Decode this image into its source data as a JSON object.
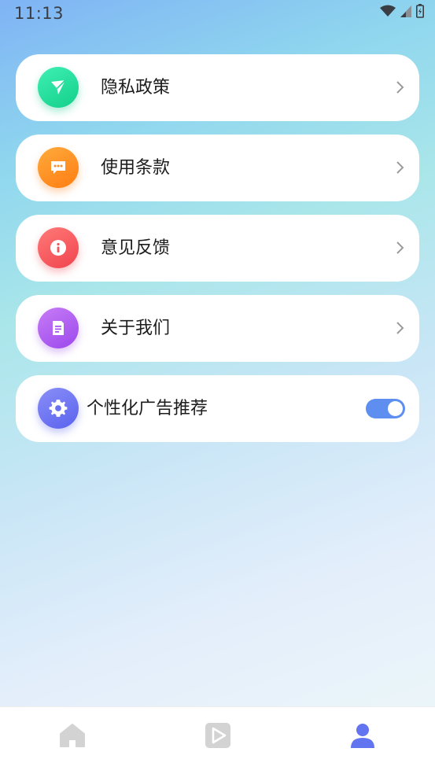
{
  "status_bar": {
    "time": "11:13"
  },
  "menu": [
    {
      "label": "隐私政策",
      "icon": "paper-plane-icon",
      "color": "#1fd99a"
    },
    {
      "label": "使用条款",
      "icon": "chat-bubble-icon",
      "color": "#ff8c22"
    },
    {
      "label": "意见反馈",
      "icon": "info-icon",
      "color": "#f5525a"
    },
    {
      "label": "关于我们",
      "icon": "document-icon",
      "color": "#a657ee"
    }
  ],
  "ad_setting": {
    "label": "个性化广告推荐",
    "icon": "gear-icon",
    "enabled": true,
    "toggle_color": "#5e8ff0"
  },
  "bottom_nav": [
    {
      "icon": "home-icon",
      "active": false
    },
    {
      "icon": "video-play-icon",
      "active": false
    },
    {
      "icon": "profile-icon",
      "active": true,
      "color": "#6274f0"
    }
  ]
}
